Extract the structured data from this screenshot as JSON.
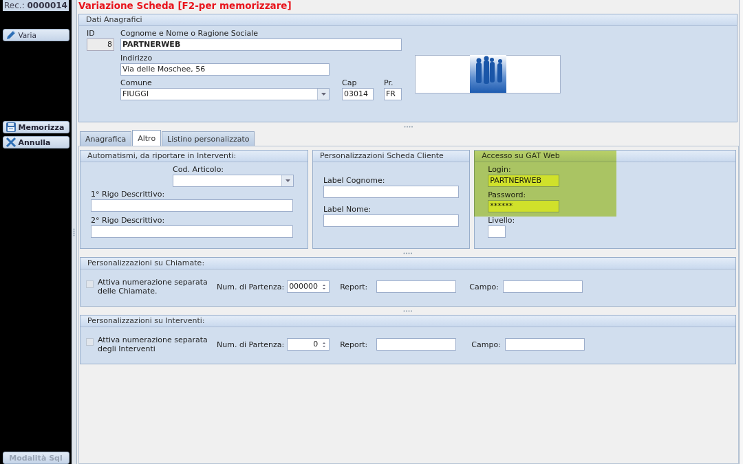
{
  "sidebar": {
    "record": {
      "label": "Rec.:",
      "value": "0000014"
    },
    "top_buttons": [
      {
        "label": "Varia",
        "kind": "edit"
      }
    ],
    "action_buttons": [
      {
        "label": "Memorizza",
        "kind": "save"
      },
      {
        "label": "Annulla",
        "kind": "cancel"
      }
    ],
    "footer_button": {
      "label": "Modalità Sql",
      "disabled": true
    }
  },
  "title": "Variazione Scheda [F2-per memorizzare]",
  "dati_anagrafici": {
    "title": "Dati Anagrafici",
    "id": {
      "label": "ID",
      "value": "8"
    },
    "name": {
      "label": "Cognome e Nome o Ragione Sociale",
      "value": "PARTNERWEB"
    },
    "address": {
      "label": "Indirizzo",
      "value": "Via delle Moschee, 56"
    },
    "comune": {
      "label": "Comune",
      "value": "FIUGGI"
    },
    "cap": {
      "label": "Cap",
      "value": "03014"
    },
    "province": {
      "label": "Pr.",
      "value": "FR"
    }
  },
  "tabs": [
    {
      "label": "Anagrafica",
      "selected": false
    },
    {
      "label": "Altro",
      "selected": true
    },
    {
      "label": "Listino personalizzato",
      "selected": false
    }
  ],
  "automatismi": {
    "title": "Automatismi, da riportare in Interventi:",
    "cod_articolo": {
      "label": "Cod. Articolo:"
    },
    "rigo_1": {
      "label": "1° Rigo Descrittivo:"
    },
    "rigo_2": {
      "label": "2° Rigo Descrittivo:"
    }
  },
  "scheda_cliente": {
    "title": "Personalizzazioni Scheda Cliente",
    "label_cognome": {
      "label": "Label Cognome:"
    },
    "label_nome": {
      "label": "Label Nome:"
    }
  },
  "accesso": {
    "title": "Accesso su GAT Web",
    "highlighted": true,
    "login": {
      "label": "Login:",
      "value": "PARTNERWEB"
    },
    "password": {
      "label": "Password:",
      "value": "******"
    },
    "livello": {
      "label": "Livello:"
    }
  },
  "sections": [
    {
      "title": "Personalizzazioni su Chiamate:",
      "checkbox": {
        "label": "Attiva numerazione separata\ndelle Chiamate.",
        "checked": false,
        "disabled": true
      },
      "start": {
        "label": "Num. di Partenza:",
        "value": "000000"
      },
      "report": {
        "label": "Report:"
      },
      "campo": {
        "label": "Campo:"
      }
    },
    {
      "title": "Personalizzazioni su Interventi:",
      "checkbox": {
        "label": "Attiva numerazione separata\ndegli Interventi",
        "checked": false,
        "disabled": true
      },
      "start": {
        "label": "Num. di Partenza:",
        "value": "0"
      },
      "report": {
        "label": "Report:"
      },
      "campo": {
        "label": "Campo:"
      }
    }
  ]
}
